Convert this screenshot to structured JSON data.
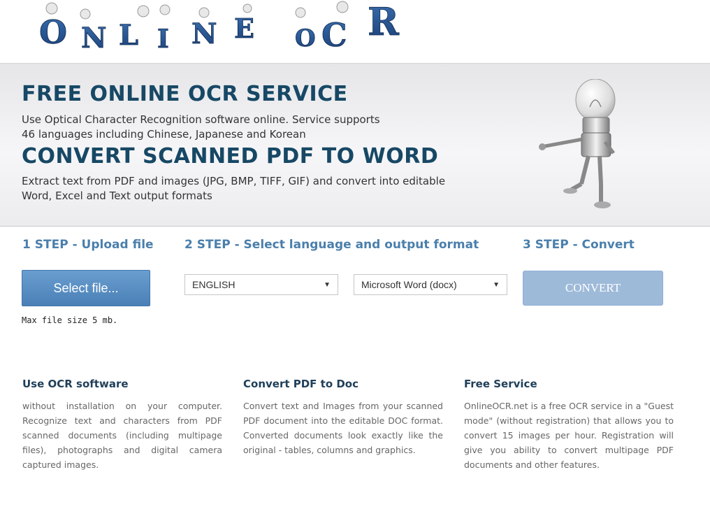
{
  "logo": {
    "letters": [
      "O",
      "N",
      "L",
      "I",
      "N",
      "E",
      "O",
      "C",
      "R"
    ]
  },
  "hero": {
    "title1": "FREE ONLINE OCR SERVICE",
    "desc1": "Use Optical Character Recognition software online. Service supports 46 languages including Chinese, Japanese and Korean",
    "title2": "CONVERT SCANNED PDF TO WORD",
    "desc2": "Extract text from PDF and images (JPG, BMP, TIFF, GIF) and convert into editable Word, Excel and Text output formats"
  },
  "steps": {
    "step1": "1 STEP - Upload file",
    "step2": "2 STEP - Select language and output format",
    "step3": "3 STEP - Convert",
    "select_file": "Select file...",
    "max_size": "Max file size 5 mb.",
    "language": "ENGLISH",
    "format": "Microsoft Word (docx)",
    "convert": "CONVERT"
  },
  "features": [
    {
      "title": "Use OCR software",
      "text": "without installation on your computer. Recognize text and characters from PDF scanned documents (including multipage files), photographs and digital camera captured images."
    },
    {
      "title": "Convert PDF to Doc",
      "text": "Convert text and Images from your scanned PDF document into the editable DOC format. Converted documents look exactly like the original - tables, columns and graphics."
    },
    {
      "title": "Free Service",
      "text": "OnlineOCR.net is a free OCR service in a \"Guest mode\" (without registration) that allows you to convert 15 images per hour. Registration will give you ability to convert multipage PDF documents and other features."
    }
  ],
  "colors": {
    "title_blue": "#174865",
    "step_blue": "#4a7fac",
    "button_blue": "#4a80b6",
    "convert_disabled": "#9ebad9"
  }
}
